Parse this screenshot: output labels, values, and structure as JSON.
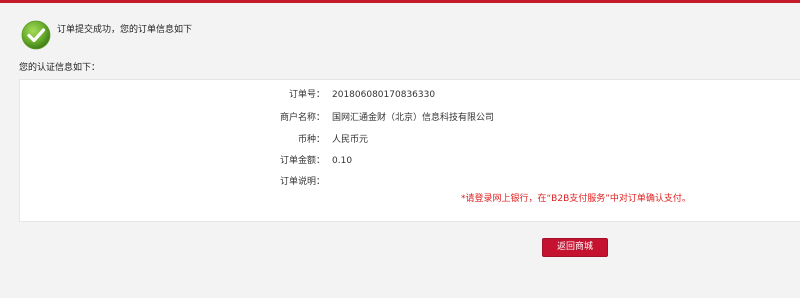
{
  "header": {
    "success_message": "订单提交成功，您的订单信息如下"
  },
  "section": {
    "title": "您的认证信息如下："
  },
  "order": {
    "fields": [
      {
        "label": "订单号：",
        "value": "201806080170836330"
      },
      {
        "label": "商户名称：",
        "value": "国网汇通金财（北京）信息科技有限公司"
      },
      {
        "label": "币种：",
        "value": "人民币元"
      },
      {
        "label": "订单金额：",
        "value": "0.10"
      },
      {
        "label": "订单说明：",
        "value": ""
      }
    ],
    "notice": "*请登录网上银行，在“B2B支付服务”中对订单确认支付。"
  },
  "actions": {
    "return_label": "返回商城"
  },
  "colors": {
    "accent": "#c41a2a",
    "success_green": "#6aae2e",
    "notice_red": "#e02020"
  },
  "icons": {
    "success": "checkmark-circle-icon"
  }
}
